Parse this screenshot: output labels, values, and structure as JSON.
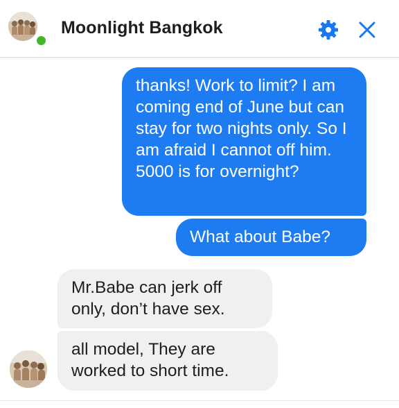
{
  "header": {
    "contact_name": "Moonlight Bangkok",
    "status": "online",
    "accent_color": "#1877f2",
    "icons": [
      "gear-icon",
      "close-icon"
    ]
  },
  "messages": [
    {
      "direction": "outgoing",
      "text": "thanks! Work to limit? I am coming end of June but can stay for two nights only. So I am afraid I cannot off him. 5000 is for overnight?"
    },
    {
      "direction": "outgoing",
      "text": "What about Babe?"
    },
    {
      "direction": "incoming",
      "text": "Mr.Babe can jerk off only, don’t have sex."
    },
    {
      "direction": "incoming",
      "text": "all model, They are worked to short time."
    }
  ],
  "colors": {
    "outgoing_bubble": "#1e7cf2",
    "incoming_bubble": "#f0f0f1",
    "online_dot": "#42b72a"
  }
}
